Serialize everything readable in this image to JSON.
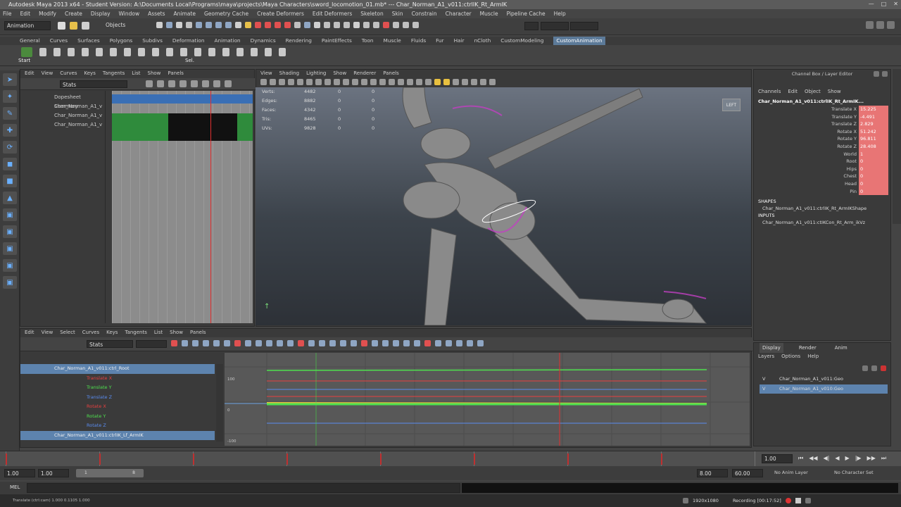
{
  "window": {
    "title": "Autodesk Maya 2013 x64 - Student Version: A:\\Documents Local\\Programs\\maya\\projects\\Maya Characters\\sword_locomotion_01.mb* --- Char_Norman_A1_v011:ctrlIK_Rt_ArmIK"
  },
  "menubar": [
    "File",
    "Edit",
    "Modify",
    "Create",
    "Display",
    "Window",
    "Assets",
    "Animate",
    "Geometry Cache",
    "Create Deformers",
    "Edit Deformers",
    "Skeleton",
    "Skin",
    "Constrain",
    "Character",
    "Muscle",
    "Pipeline Cache",
    "Help"
  ],
  "statusline": {
    "mode": "Animation",
    "objects_label": "Objects"
  },
  "shelf_tabs": [
    "General",
    "Curves",
    "Surfaces",
    "Polygons",
    "Subdivs",
    "Deformation",
    "Animation",
    "Dynamics",
    "Rendering",
    "PaintEffects",
    "Toon",
    "Muscle",
    "Fluids",
    "Fur",
    "Hair",
    "nCloth",
    "CustomModeling",
    "CustomAnimation"
  ],
  "shelf_active": "CustomAnimation",
  "shelf_buttons": {
    "start": "Start",
    "sel": "Sel."
  },
  "dopesheet": {
    "menu": [
      "Edit",
      "View",
      "Curves",
      "Keys",
      "Tangents",
      "List",
      "Show",
      "Panels"
    ],
    "stats_label": "Stats",
    "rows": [
      "Dopesheet Summary",
      "Char_Norman_A1_v",
      "Char_Norman_A1_v",
      "Char_Norman_A1_v"
    ]
  },
  "viewport": {
    "menu": [
      "View",
      "Shading",
      "Lighting",
      "Show",
      "Renderer",
      "Panels"
    ],
    "hud": [
      {
        "label": "Verts:",
        "a": "4482",
        "b": "0",
        "c": "0"
      },
      {
        "label": "Edges:",
        "a": "8882",
        "b": "0",
        "c": "0"
      },
      {
        "label": "Faces:",
        "a": "4342",
        "b": "0",
        "c": "0"
      },
      {
        "label": "Tris:",
        "a": "8465",
        "b": "0",
        "c": "0"
      },
      {
        "label": "UVs:",
        "a": "9828",
        "b": "0",
        "c": "0"
      }
    ],
    "viewcube": "LEFT"
  },
  "channelbox": {
    "header": "Channel Box / Layer Editor",
    "menu": [
      "Channels",
      "Edit",
      "Object",
      "Show"
    ],
    "object": "Char_Norman_A1_v011:ctrlIK_Rt_ArmIK...",
    "attrs": [
      {
        "name": "Translate X",
        "value": "15.225"
      },
      {
        "name": "Translate Y",
        "value": "-4.491"
      },
      {
        "name": "Translate Z",
        "value": "2.829"
      },
      {
        "name": "Rotate X",
        "value": "51.242"
      },
      {
        "name": "Rotate Y",
        "value": "96.811"
      },
      {
        "name": "Rotate Z",
        "value": "28.408"
      },
      {
        "name": "",
        "value": ""
      },
      {
        "name": "World",
        "value": "1"
      },
      {
        "name": "Root",
        "value": "0"
      },
      {
        "name": "Hips",
        "value": "0"
      },
      {
        "name": "Chest",
        "value": "0"
      },
      {
        "name": "Head",
        "value": "0"
      },
      {
        "name": "Pin",
        "value": "0"
      }
    ],
    "shapes_label": "SHAPES",
    "shape": "Char_Norman_A1_v011:ctrlIK_Rt_ArmIKShape",
    "inputs_label": "INPUTS",
    "input": "Char_Norman_A1_v011:ctIKCon_Rt_Arm_ikVz"
  },
  "layers": {
    "tabs": [
      "Display",
      "Render",
      "Anim"
    ],
    "menu": [
      "Layers",
      "Options",
      "Help"
    ],
    "items": [
      {
        "vis": "V",
        "name": "Char_Norman_A1_v011:Geo"
      },
      {
        "vis": "V",
        "name": "Char_Norman_A1_v010:Geo"
      }
    ]
  },
  "graph_editor": {
    "menu": [
      "Edit",
      "View",
      "Select",
      "Curves",
      "Keys",
      "Tangents",
      "List",
      "Show",
      "Panels"
    ],
    "stats_label": "Stats",
    "outliner": [
      {
        "text": "Char_Norman_A1_v011:ctrl_Root",
        "color": "#f0f0f0"
      },
      {
        "text": "Translate X",
        "color": "#e84040"
      },
      {
        "text": "Translate Y",
        "color": "#4ee04e"
      },
      {
        "text": "Translate Z",
        "color": "#5a8cf0"
      },
      {
        "text": "Rotate X",
        "color": "#e84040"
      },
      {
        "text": "Rotate Y",
        "color": "#4ee04e"
      },
      {
        "text": "Rotate Z",
        "color": "#5a8cf0"
      },
      {
        "text": "Char_Norman_A1_v011:ctrlIK_Lf_ArmIK",
        "color": "#f0f0f0"
      }
    ],
    "y_labels": [
      "100",
      "0",
      "-100"
    ]
  },
  "timeline": {
    "start": "1.00",
    "start2": "1.00",
    "range_a": "1",
    "range_b": "8",
    "end": "8.00",
    "end2": "60.00",
    "current": "1.00"
  },
  "playback": {
    "anim_layer": "No Anim Layer",
    "char_set": "No Character Set"
  },
  "cmdline": {
    "lang": "MEL"
  },
  "helpline": "Translate (ctrl:cam) 1.000 0.1105 1.000",
  "taskbar": {
    "resolution": "1920x1080",
    "recording": "Recording [00:17:52]"
  }
}
